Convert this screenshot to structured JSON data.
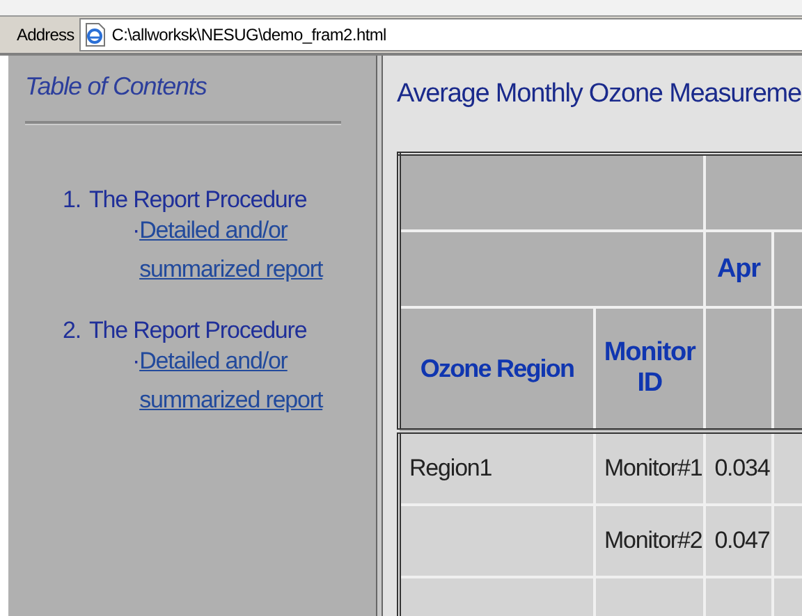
{
  "address_bar": {
    "label": "Address",
    "url": "C:\\allworksk\\NESUG\\demo_fram2.html"
  },
  "toc": {
    "title": "Table of Contents",
    "items": [
      {
        "number": "1.",
        "title": "The Report Procedure",
        "bullet": "·",
        "link": "Detailed and/or summarized report"
      },
      {
        "number": "2.",
        "title": "The Report Procedure",
        "bullet": "·",
        "link": "Detailed and/or summarized report"
      }
    ]
  },
  "report": {
    "title": "Average Monthly Ozone Measureme",
    "table": {
      "columns": [
        "Ozone Region",
        "Monitor ID"
      ],
      "month_headers": [
        "Apr"
      ],
      "rows": [
        {
          "region": "Region1",
          "monitor": "Monitor#1",
          "values": [
            "0.034"
          ]
        },
        {
          "monitor": "Monitor#2",
          "values": [
            "0.047"
          ]
        },
        {}
      ]
    }
  }
}
